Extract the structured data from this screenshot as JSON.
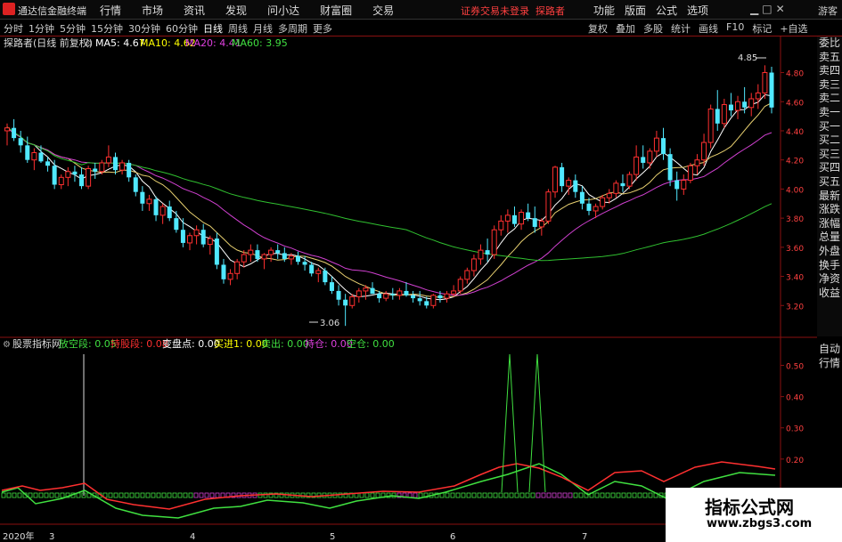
{
  "titlebar": {
    "app_name": "通达信金融终端",
    "menu": [
      "行情",
      "市场",
      "资讯",
      "发现",
      "问小达",
      "财富圈",
      "交易"
    ],
    "login_status": "证券交易未登录",
    "user": "探路者",
    "right_menu": [
      "功能",
      "版面",
      "公式",
      "选项"
    ],
    "guest": "游客"
  },
  "toolbar": {
    "periods": [
      "分时",
      "1分钟",
      "5分钟",
      "15分钟",
      "30分钟",
      "60分钟",
      "日线",
      "周线",
      "月线",
      "多周期",
      "更多"
    ],
    "selected_period": "日线",
    "tools": [
      "复权",
      "叠加",
      "多股",
      "统计",
      "画线",
      "F10",
      "标记",
      "+自选"
    ]
  },
  "main_chart": {
    "header": {
      "title": "探路者(日线 前复权)",
      "ma": [
        {
          "label": "MA5: 4.67",
          "color": "#ffffff"
        },
        {
          "label": "MA10: 4.62",
          "color": "#ffff00"
        },
        {
          "label": "MA20: 4.41",
          "color": "#e040e0"
        },
        {
          "label": "MA60: 3.95",
          "color": "#40e040"
        }
      ]
    },
    "high_label": "4.85",
    "low_label": "3.06"
  },
  "indicator": {
    "header": {
      "name": "股票指标网",
      "items": [
        {
          "label": "放空段: 0.05",
          "color": "#40e040"
        },
        {
          "label": "持股段: 0.08",
          "color": "#ff3030"
        },
        {
          "label": "变盘点: 0.00",
          "color": "#ffffff"
        },
        {
          "label": "买进1: 0.00",
          "color": "#ffff00"
        },
        {
          "label": "卖出: 0.00",
          "color": "#40e040"
        },
        {
          "label": "持仓: 0.00",
          "color": "#e040e0"
        },
        {
          "label": "空仓: 0.00",
          "color": "#40e040"
        }
      ]
    }
  },
  "date_axis": {
    "year": "2020年",
    "months": [
      "3",
      "4",
      "5",
      "6",
      "7"
    ]
  },
  "side_panel": [
    "委比",
    "卖五",
    "卖四",
    "卖三",
    "卖二",
    "卖一",
    "买一",
    "买二",
    "买三",
    "买四",
    "买五",
    "最新",
    "涨跌",
    "涨幅",
    "总量",
    "外盘",
    "换手",
    "净资",
    "收益"
  ],
  "side_panel2": [
    "自动",
    "行情"
  ],
  "watermark": {
    "title": "指标公式网",
    "url": "www.zbgs3.com"
  },
  "chart_data": [
    {
      "type": "candlestick",
      "title": "探路者(日线 前复权)",
      "ylim": [
        3.0,
        4.95
      ],
      "yticks": [
        3.2,
        3.4,
        3.6,
        3.8,
        4.0,
        4.2,
        4.4,
        4.6,
        4.8
      ],
      "ohlc": [
        [
          4.4,
          4.45,
          4.3,
          4.42
        ],
        [
          4.42,
          4.48,
          4.33,
          4.35
        ],
        [
          4.35,
          4.4,
          4.25,
          4.3
        ],
        [
          4.3,
          4.36,
          4.18,
          4.2
        ],
        [
          4.2,
          4.28,
          4.13,
          4.25
        ],
        [
          4.25,
          4.3,
          4.18,
          4.19
        ],
        [
          4.19,
          4.22,
          4.12,
          4.16
        ],
        [
          4.16,
          4.2,
          4.0,
          4.03
        ],
        [
          4.03,
          4.1,
          4.0,
          4.08
        ],
        [
          4.08,
          4.15,
          4.02,
          4.12
        ],
        [
          4.12,
          4.16,
          4.05,
          4.1
        ],
        [
          4.1,
          4.15,
          4.0,
          4.02
        ],
        [
          4.02,
          4.16,
          4.0,
          4.14
        ],
        [
          4.14,
          4.18,
          4.07,
          4.12
        ],
        [
          4.12,
          4.2,
          4.1,
          4.18
        ],
        [
          4.18,
          4.3,
          4.15,
          4.22
        ],
        [
          4.22,
          4.25,
          4.1,
          4.13
        ],
        [
          4.13,
          4.2,
          4.1,
          4.18
        ],
        [
          4.18,
          4.2,
          4.05,
          4.08
        ],
        [
          4.08,
          4.1,
          3.95,
          3.98
        ],
        [
          3.98,
          4.02,
          3.85,
          3.9
        ],
        [
          3.9,
          3.96,
          3.85,
          3.93
        ],
        [
          3.93,
          3.95,
          3.78,
          3.82
        ],
        [
          3.82,
          3.9,
          3.76,
          3.88
        ],
        [
          3.88,
          3.92,
          3.78,
          3.8
        ],
        [
          3.8,
          3.85,
          3.7,
          3.72
        ],
        [
          3.72,
          3.8,
          3.6,
          3.63
        ],
        [
          3.63,
          3.7,
          3.58,
          3.68
        ],
        [
          3.68,
          3.75,
          3.62,
          3.72
        ],
        [
          3.72,
          3.76,
          3.6,
          3.62
        ],
        [
          3.62,
          3.68,
          3.55,
          3.66
        ],
        [
          3.66,
          3.7,
          3.45,
          3.48
        ],
        [
          3.48,
          3.52,
          3.35,
          3.38
        ],
        [
          3.38,
          3.45,
          3.34,
          3.42
        ],
        [
          3.42,
          3.52,
          3.38,
          3.5
        ],
        [
          3.5,
          3.58,
          3.46,
          3.55
        ],
        [
          3.55,
          3.62,
          3.5,
          3.58
        ],
        [
          3.58,
          3.62,
          3.5,
          3.52
        ],
        [
          3.52,
          3.56,
          3.45,
          3.55
        ],
        [
          3.55,
          3.6,
          3.5,
          3.58
        ],
        [
          3.58,
          3.62,
          3.52,
          3.56
        ],
        [
          3.56,
          3.6,
          3.5,
          3.52
        ],
        [
          3.52,
          3.56,
          3.48,
          3.54
        ],
        [
          3.54,
          3.57,
          3.48,
          3.5
        ],
        [
          3.5,
          3.54,
          3.44,
          3.48
        ],
        [
          3.48,
          3.5,
          3.4,
          3.42
        ],
        [
          3.42,
          3.46,
          3.36,
          3.44
        ],
        [
          3.44,
          3.46,
          3.34,
          3.36
        ],
        [
          3.36,
          3.4,
          3.28,
          3.3
        ],
        [
          3.3,
          3.34,
          3.2,
          3.24
        ],
        [
          3.24,
          3.28,
          3.06,
          3.2
        ],
        [
          3.2,
          3.28,
          3.18,
          3.26
        ],
        [
          3.26,
          3.32,
          3.22,
          3.3
        ],
        [
          3.3,
          3.34,
          3.24,
          3.32
        ],
        [
          3.32,
          3.36,
          3.28,
          3.28
        ],
        [
          3.28,
          3.3,
          3.22,
          3.25
        ],
        [
          3.25,
          3.3,
          3.23,
          3.28
        ],
        [
          3.28,
          3.32,
          3.24,
          3.27
        ],
        [
          3.27,
          3.32,
          3.24,
          3.3
        ],
        [
          3.3,
          3.36,
          3.26,
          3.27
        ],
        [
          3.27,
          3.3,
          3.22,
          3.25
        ],
        [
          3.25,
          3.3,
          3.2,
          3.23
        ],
        [
          3.23,
          3.26,
          3.18,
          3.2
        ],
        [
          3.2,
          3.28,
          3.18,
          3.27
        ],
        [
          3.27,
          3.3,
          3.22,
          3.25
        ],
        [
          3.25,
          3.3,
          3.22,
          3.28
        ],
        [
          3.28,
          3.34,
          3.26,
          3.3
        ],
        [
          3.3,
          3.4,
          3.28,
          3.38
        ],
        [
          3.38,
          3.46,
          3.35,
          3.44
        ],
        [
          3.44,
          3.55,
          3.4,
          3.52
        ],
        [
          3.52,
          3.62,
          3.48,
          3.58
        ],
        [
          3.58,
          3.66,
          3.5,
          3.55
        ],
        [
          3.55,
          3.75,
          3.52,
          3.72
        ],
        [
          3.72,
          3.82,
          3.68,
          3.78
        ],
        [
          3.78,
          3.86,
          3.7,
          3.82
        ],
        [
          3.82,
          3.88,
          3.74,
          3.76
        ],
        [
          3.76,
          3.86,
          3.72,
          3.84
        ],
        [
          3.84,
          3.9,
          3.78,
          3.8
        ],
        [
          3.8,
          3.88,
          3.7,
          3.74
        ],
        [
          3.74,
          3.8,
          3.68,
          3.78
        ],
        [
          3.78,
          4.0,
          3.76,
          3.98
        ],
        [
          3.98,
          4.16,
          3.94,
          4.15
        ],
        [
          4.15,
          4.18,
          3.98,
          4.02
        ],
        [
          4.02,
          4.08,
          3.96,
          4.06
        ],
        [
          4.06,
          4.1,
          3.94,
          3.98
        ],
        [
          3.98,
          4.02,
          3.86,
          3.9
        ],
        [
          3.9,
          3.94,
          3.82,
          3.85
        ],
        [
          3.85,
          3.9,
          3.8,
          3.88
        ],
        [
          3.88,
          3.96,
          3.86,
          3.94
        ],
        [
          3.94,
          4.0,
          3.9,
          3.97
        ],
        [
          3.97,
          4.06,
          3.94,
          4.04
        ],
        [
          4.04,
          4.1,
          3.98,
          4.02
        ],
        [
          4.02,
          4.12,
          4.0,
          4.1
        ],
        [
          4.1,
          4.3,
          4.06,
          4.22
        ],
        [
          4.22,
          4.3,
          4.14,
          4.18
        ],
        [
          4.18,
          4.28,
          4.14,
          4.26
        ],
        [
          4.26,
          4.4,
          4.22,
          4.35
        ],
        [
          4.35,
          4.42,
          4.2,
          4.24
        ],
        [
          4.24,
          4.28,
          4.02,
          4.06
        ],
        [
          4.06,
          4.12,
          3.92,
          4.0
        ],
        [
          4.0,
          4.1,
          3.96,
          4.06
        ],
        [
          4.06,
          4.18,
          4.04,
          4.16
        ],
        [
          4.16,
          4.24,
          4.1,
          4.2
        ],
        [
          4.2,
          4.38,
          4.16,
          4.32
        ],
        [
          4.32,
          4.58,
          4.28,
          4.55
        ],
        [
          4.55,
          4.68,
          4.4,
          4.45
        ],
        [
          4.45,
          4.62,
          4.42,
          4.58
        ],
        [
          4.58,
          4.66,
          4.5,
          4.54
        ],
        [
          4.54,
          4.64,
          4.48,
          4.6
        ],
        [
          4.6,
          4.7,
          4.52,
          4.56
        ],
        [
          4.56,
          4.66,
          4.5,
          4.62
        ],
        [
          4.62,
          4.72,
          4.55,
          4.66
        ],
        [
          4.66,
          4.85,
          4.62,
          4.8
        ],
        [
          4.8,
          4.84,
          4.52,
          4.56
        ]
      ],
      "series": [
        {
          "name": "MA5",
          "values": [
            4.65,
            4.67
          ]
        },
        {
          "name": "MA10",
          "values": [
            4.6,
            4.62
          ]
        },
        {
          "name": "MA20",
          "values": [
            4.39,
            4.41
          ]
        },
        {
          "name": "MA60",
          "values": [
            3.93,
            3.95
          ]
        }
      ]
    },
    {
      "type": "line",
      "title": "股票指标网",
      "ylim": [
        0,
        0.55
      ],
      "yticks": [
        0.1,
        0.2,
        0.3,
        0.4,
        0.5
      ],
      "series": [
        {
          "name": "放空段",
          "last": 0.05
        },
        {
          "name": "持股段",
          "last": 0.08
        }
      ]
    }
  ]
}
